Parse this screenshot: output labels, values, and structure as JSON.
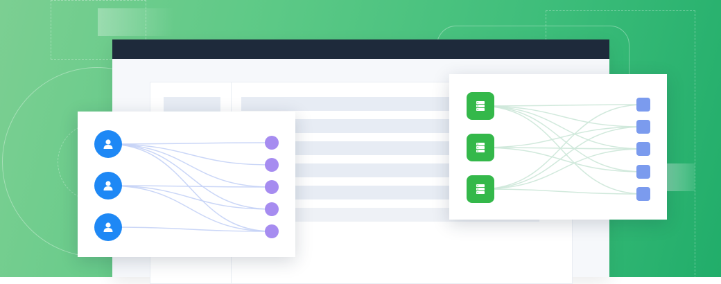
{
  "colors": {
    "user_node": "#1e88f5",
    "user_target": "#a68cf0",
    "server_node": "#34b84a",
    "server_target": "#7b9bee",
    "user_links": "#c4d2f6",
    "server_links": "#cfe8da",
    "titlebar": "#1e2a3b"
  },
  "left_card": {
    "source_icon": "user-icon",
    "sources": 3,
    "targets": 5
  },
  "right_card": {
    "source_icon": "database-server-icon",
    "sources": 3,
    "targets": 5
  }
}
